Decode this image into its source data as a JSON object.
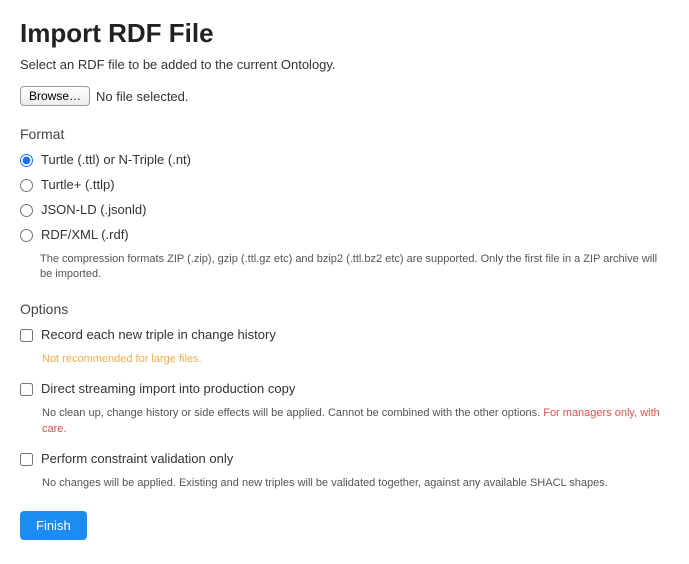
{
  "title": "Import RDF File",
  "intro": "Select an RDF file to be added to the current Ontology.",
  "file": {
    "browse_label": "Browse…",
    "status": "No file selected."
  },
  "format": {
    "heading": "Format",
    "options": [
      {
        "label": "Turtle (.ttl) or N-Triple (.nt)",
        "selected": true
      },
      {
        "label": "Turtle+ (.ttlp)",
        "selected": false
      },
      {
        "label": "JSON-LD (.jsonld)",
        "selected": false
      },
      {
        "label": "RDF/XML (.rdf)",
        "selected": false
      }
    ],
    "compression_note": "The compression formats ZIP (.zip), gzip (.ttl.gz etc) and bzip2 (.ttl.bz2 etc) are supported. Only the first file in a ZIP archive will be imported."
  },
  "options": {
    "heading": "Options",
    "items": [
      {
        "label": "Record each new triple in change history",
        "sub_warn_orange": "Not recommended for large files."
      },
      {
        "label": "Direct streaming import into production copy",
        "sub_text": "No clean up, change history or side effects will be applied. Cannot be combined with the other options. ",
        "sub_warn_red": "For managers only, with care."
      },
      {
        "label": "Perform constraint validation only",
        "sub_text": "No changes will be applied. Existing and new triples will be validated together, against any available SHACL shapes."
      }
    ]
  },
  "finish_label": "Finish"
}
